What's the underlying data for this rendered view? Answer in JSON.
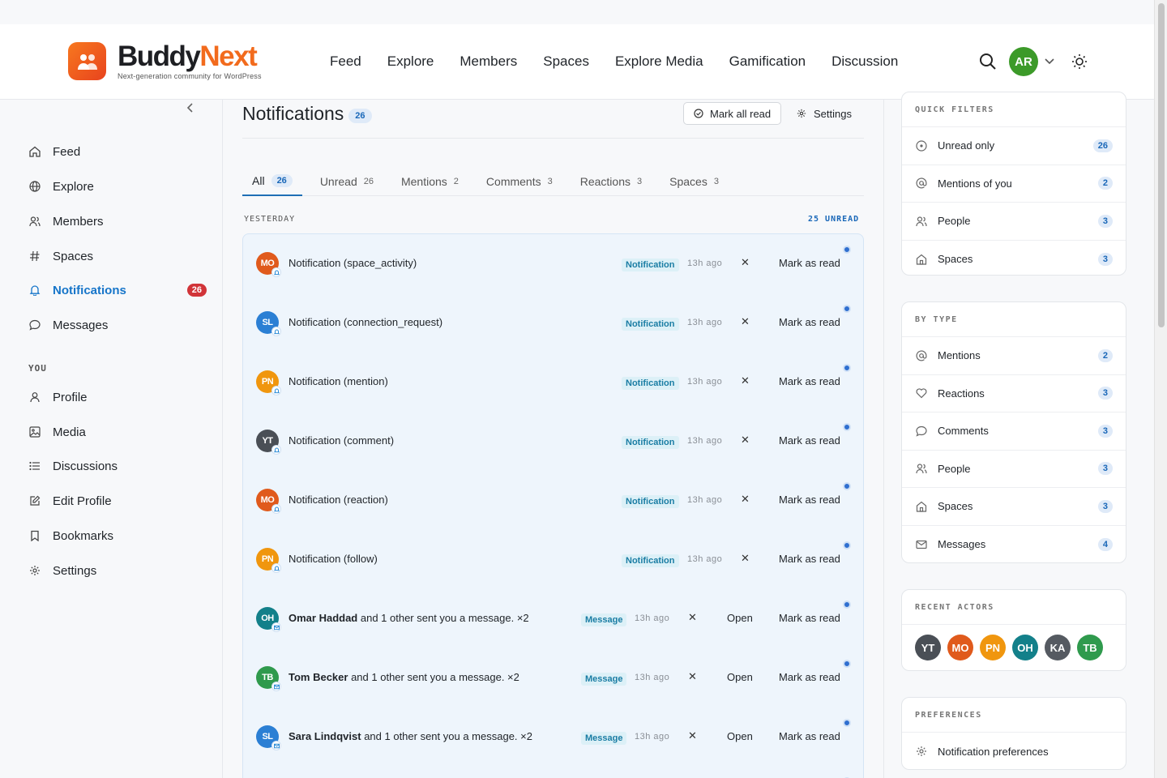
{
  "brand": {
    "name_part1": "Buddy",
    "name_part2": "Next",
    "tagline": "Next-generation community for WordPress"
  },
  "topnav": [
    "Feed",
    "Explore",
    "Members",
    "Spaces",
    "Explore Media",
    "Gamification",
    "Discussion"
  ],
  "user": {
    "initials": "AR",
    "color": "#3c9a29"
  },
  "sidebar": {
    "main": [
      {
        "label": "Feed",
        "icon": "home-icon"
      },
      {
        "label": "Explore",
        "icon": "globe-icon"
      },
      {
        "label": "Members",
        "icon": "users-icon"
      },
      {
        "label": "Spaces",
        "icon": "hash-icon"
      },
      {
        "label": "Notifications",
        "icon": "bell-icon",
        "badge": "26",
        "active": true
      },
      {
        "label": "Messages",
        "icon": "chat-icon"
      }
    ],
    "you_label": "YOU",
    "you": [
      {
        "label": "Profile",
        "icon": "user-icon"
      },
      {
        "label": "Media",
        "icon": "image-icon"
      },
      {
        "label": "Discussions",
        "icon": "list-icon"
      },
      {
        "label": "Edit Profile",
        "icon": "edit-icon"
      },
      {
        "label": "Bookmarks",
        "icon": "bookmark-icon"
      },
      {
        "label": "Settings",
        "icon": "gear-icon"
      }
    ]
  },
  "main": {
    "title": "Notifications",
    "title_count": "26",
    "mark_all_read": "Mark all read",
    "settings": "Settings",
    "tabs": [
      {
        "label": "All",
        "count": "26",
        "active": true
      },
      {
        "label": "Unread",
        "count": "26"
      },
      {
        "label": "Mentions",
        "count": "2"
      },
      {
        "label": "Comments",
        "count": "3"
      },
      {
        "label": "Reactions",
        "count": "3"
      },
      {
        "label": "Spaces",
        "count": "3"
      }
    ],
    "group_label": "YESTERDAY",
    "unread_label": "25 UNREAD",
    "notifications": [
      {
        "initials": "MO",
        "color": "#e05a1c",
        "bold": "",
        "text": "Notification (space_activity)",
        "tag": "Notification",
        "time": "13h ago",
        "open": "",
        "mark": "Mark as read",
        "mini": "bell"
      },
      {
        "initials": "SL",
        "color": "#2b7fd4",
        "bold": "",
        "text": "Notification (connection_request)",
        "tag": "Notification",
        "time": "13h ago",
        "open": "",
        "mark": "Mark as read",
        "mini": "bell"
      },
      {
        "initials": "PN",
        "color": "#f0960e",
        "bold": "",
        "text": "Notification (mention)",
        "tag": "Notification",
        "time": "13h ago",
        "open": "",
        "mark": "Mark as read",
        "mini": "bell"
      },
      {
        "initials": "YT",
        "color": "#4a4f56",
        "bold": "",
        "text": "Notification (comment)",
        "tag": "Notification",
        "time": "13h ago",
        "open": "",
        "mark": "Mark as read",
        "mini": "bell"
      },
      {
        "initials": "MO",
        "color": "#e05a1c",
        "bold": "",
        "text": "Notification (reaction)",
        "tag": "Notification",
        "time": "13h ago",
        "open": "",
        "mark": "Mark as read",
        "mini": "bell"
      },
      {
        "initials": "PN",
        "color": "#f0960e",
        "bold": "",
        "text": "Notification (follow)",
        "tag": "Notification",
        "time": "13h ago",
        "open": "",
        "mark": "Mark as read",
        "mini": "bell"
      },
      {
        "initials": "OH",
        "color": "#13808a",
        "bold": "Omar Haddad",
        "text": " and 1 other sent you a message. ×2",
        "tag": "Message",
        "time": "13h ago",
        "open": "Open",
        "mark": "Mark as read",
        "mini": "mail"
      },
      {
        "initials": "TB",
        "color": "#2f9a4d",
        "bold": "Tom Becker",
        "text": " and 1 other sent you a message. ×2",
        "tag": "Message",
        "time": "13h ago",
        "open": "Open",
        "mark": "Mark as read",
        "mini": "mail"
      },
      {
        "initials": "SL",
        "color": "#2b7fd4",
        "bold": "Sara Lindqvist",
        "text": " and 1 other sent you a message. ×2",
        "tag": "Message",
        "time": "13h ago",
        "open": "Open",
        "mark": "Mark as read",
        "mini": "mail"
      }
    ]
  },
  "right": {
    "quick_filters": {
      "title": "QUICK FILTERS",
      "items": [
        {
          "label": "Unread only",
          "count": "26",
          "icon": "circle-icon"
        },
        {
          "label": "Mentions of you",
          "count": "2",
          "icon": "at-icon"
        },
        {
          "label": "People",
          "count": "3",
          "icon": "users-icon"
        },
        {
          "label": "Spaces",
          "count": "3",
          "icon": "building-icon"
        }
      ]
    },
    "by_type": {
      "title": "BY TYPE",
      "items": [
        {
          "label": "Mentions",
          "count": "2",
          "icon": "at-icon"
        },
        {
          "label": "Reactions",
          "count": "3",
          "icon": "heart-icon"
        },
        {
          "label": "Comments",
          "count": "3",
          "icon": "chat-icon"
        },
        {
          "label": "People",
          "count": "3",
          "icon": "users-icon"
        },
        {
          "label": "Spaces",
          "count": "3",
          "icon": "building-icon"
        },
        {
          "label": "Messages",
          "count": "4",
          "icon": "mail-icon"
        }
      ]
    },
    "recent_actors": {
      "title": "RECENT ACTORS",
      "actors": [
        {
          "initials": "YT",
          "color": "#4a4f56"
        },
        {
          "initials": "MO",
          "color": "#e05a1c"
        },
        {
          "initials": "PN",
          "color": "#f0960e"
        },
        {
          "initials": "OH",
          "color": "#13808a"
        },
        {
          "initials": "KA",
          "color": "#555a61"
        },
        {
          "initials": "TB",
          "color": "#2f9a4d"
        }
      ]
    },
    "preferences": {
      "title": "PREFERENCES",
      "item": "Notification preferences"
    }
  }
}
